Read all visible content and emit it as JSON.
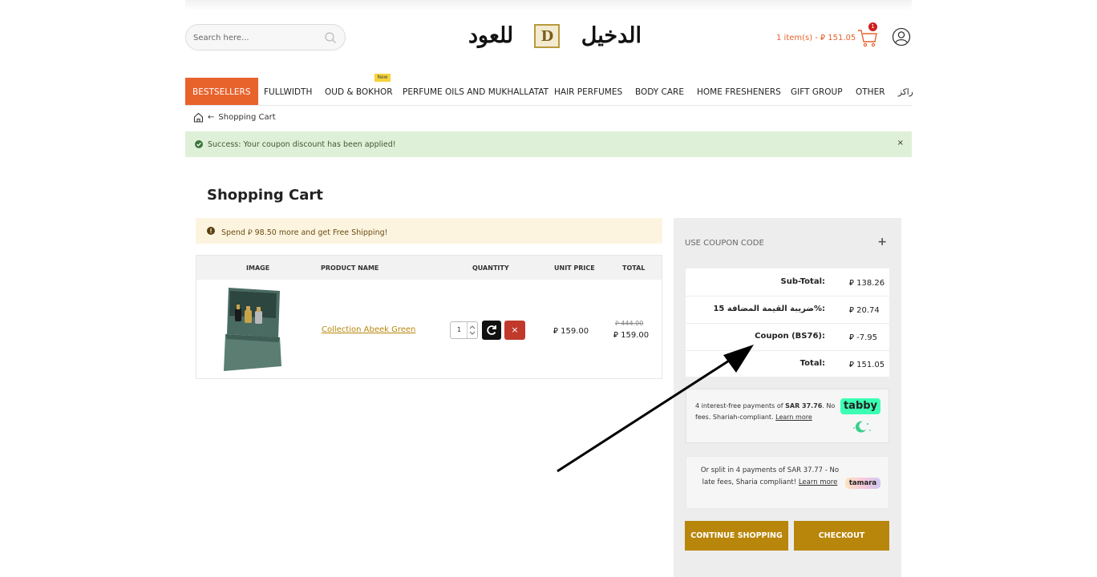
{
  "header": {
    "search_placeholder": "Search here...",
    "logo_text_right": "الدخيل",
    "logo_emblem": "D",
    "logo_text_left": "للعود",
    "cart_summary": "1 item(s) - ⃁ 151.05",
    "cart_count": "1"
  },
  "nav": {
    "items": [
      "BESTSELLERS",
      "FULLWIDTH",
      "OUD & BOKHOR",
      "PERFUME OILS AND MUKHALLATAT",
      "HAIR PERFUMES",
      "BODY CARE",
      "HOME FRESHENERS",
      "GIFT GROUP",
      "OTHER",
      "راكز"
    ],
    "new_badge": "New"
  },
  "breadcrumb": {
    "separator": "←",
    "current": "Shopping Cart"
  },
  "alert": {
    "message": "Success: Your coupon discount has been applied!",
    "close": "×"
  },
  "page_title": "Shopping Cart",
  "shipping_notice": "Spend ⃁ 98.50 more and get Free Shipping!",
  "table": {
    "headers": [
      "IMAGE",
      "PRODUCT NAME",
      "QUANTITY",
      "UNIT PRICE",
      "TOTAL"
    ],
    "rows": [
      {
        "name": "Collection Abeek Green",
        "quantity": "1",
        "unit_price": "⃁ 159.00",
        "old_total": "⃁ 444.00",
        "total": "⃁ 159.00",
        "remove": "×"
      }
    ]
  },
  "sidebar": {
    "coupon_label": "USE COUPON CODE",
    "coupon_toggle": "+",
    "totals": [
      {
        "label": "Sub-Total:",
        "value": "⃁ 138.26"
      },
      {
        "label": "15 ضريبة القيمة المضافة%:",
        "value": "⃁ 20.74"
      },
      {
        "label": "Coupon (BS76):",
        "value": "⃁ -7.95"
      },
      {
        "label": "Total:",
        "value": "⃁ 151.05"
      }
    ],
    "tabby": {
      "text_before": "4 interest-free payments of ",
      "amount": "SAR 37.76",
      "text_after": ". No fees. Shariah-compliant. ",
      "link": "Learn more",
      "logo": "tabby"
    },
    "tamara": {
      "text": "Or split in 4 payments of SAR 37.77 - No late fees, Sharia compliant! ",
      "link": "Learn more",
      "logo": "tamara"
    },
    "continue_button": "CONTINUE SHOPPING",
    "checkout_button": "CHECKOUT"
  },
  "colors": {
    "accent": "#e8622c",
    "gold": "#b8860b",
    "success_bg": "#dff0d8",
    "notice_bg": "#fdf4e0",
    "tabby_green": "#3bffb2"
  }
}
